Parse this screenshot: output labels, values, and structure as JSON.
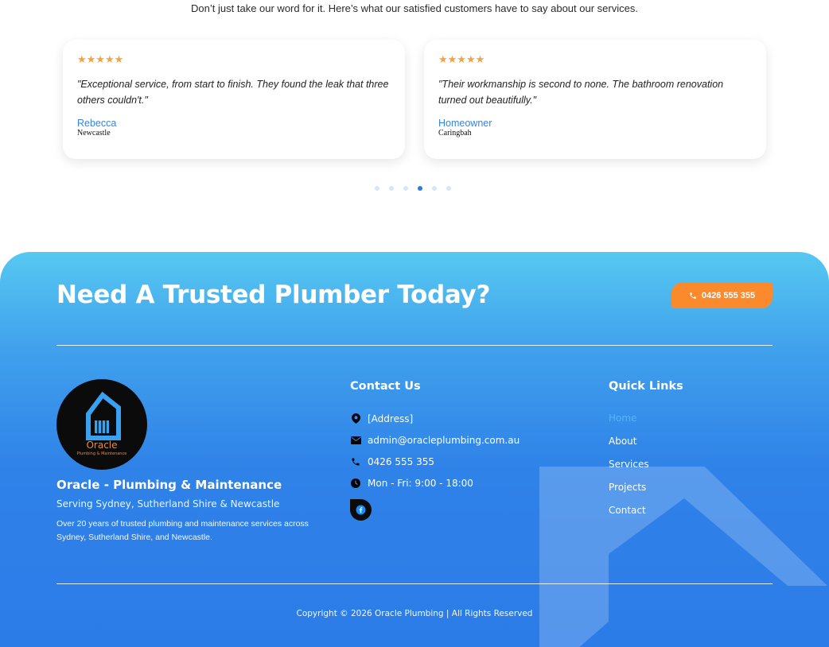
{
  "testimonials": {
    "intro": "Don’t just take our word for it. Here’s what our satisfied customers have to say about our services.",
    "star_color": "#f2a444",
    "cards": [
      {
        "stars": "★★★★★",
        "quote": "\"Exceptional service, from start to finish. They found the leak that three others couldn't.\"",
        "name": "Rebecca",
        "location": "Newcastle"
      },
      {
        "stars": "★★★★★",
        "quote": "\"Their workmanship is second to none. The bathroom renovation turned out beautifully.\"",
        "name": "Homeowner",
        "location": "Caringbah"
      }
    ],
    "pagination": {
      "total": 6,
      "active": 4
    }
  },
  "cta": {
    "title": "Need A Trusted Plumber Today?",
    "phone_button": "0426 555 355",
    "phone_icon": "phone-icon",
    "button_color": "#fb8a2d"
  },
  "footer": {
    "logo": {
      "text": "Oracle",
      "subtext": "Plumbing & Maintenance"
    },
    "brand_name": "Oracle - Plumbing & Maintenance",
    "tagline": "Serving Sydney, Sutherland Shire & Newcastle",
    "description": "Over 20 years of trusted plumbing and maintenance services across Sydney, Sutherland Shire, and Newcastle.",
    "contact": {
      "title": "Contact Us",
      "address": "[Address]",
      "email": "admin@oracleplumbing.com.au",
      "phone": "0426 555 355",
      "hours": "Mon - Fri: 9:00 - 18:00",
      "social_icon": "facebook-icon"
    },
    "quick_links": {
      "title": "Quick Links",
      "items": [
        "Home",
        "About",
        "Services",
        "Projects",
        "Contact"
      ],
      "active": "Home"
    },
    "copyright": "Copyright © 2026 Oracle Plumbing | All Rights Reserved",
    "gradient_top": "#56c8f1",
    "gradient_bottom": "#2c7ce8"
  }
}
